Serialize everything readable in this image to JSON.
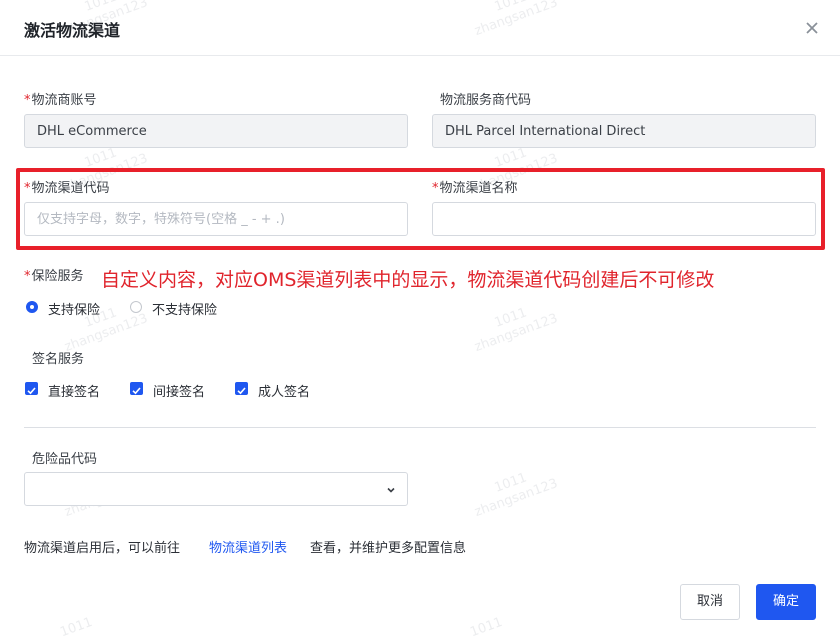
{
  "dialog": {
    "title": "激活物流渠道",
    "close_icon": "close-icon"
  },
  "fields": {
    "carrier_account": {
      "label": "物流商账号",
      "required": "*",
      "value": "DHL eCommerce"
    },
    "carrier_service_code": {
      "label": "物流服务商代码",
      "value": "DHL Parcel International Direct"
    },
    "channel_code": {
      "label": "物流渠道代码",
      "required": "*",
      "placeholder": "仅支持字母，数字，特殊符号(空格 _ - + .)"
    },
    "channel_name": {
      "label": "物流渠道名称",
      "required": "*",
      "value": ""
    }
  },
  "annotation": "自定义内容，对应OMS渠道列表中的显示，物流渠道代码创建后不可修改",
  "insurance": {
    "label": "保险服务",
    "required": "*",
    "options": [
      {
        "label": "支持保险",
        "checked": true
      },
      {
        "label": "不支持保险",
        "checked": false
      }
    ]
  },
  "signature": {
    "label": "签名服务",
    "options": [
      {
        "label": "直接签名",
        "checked": true
      },
      {
        "label": "间接签名",
        "checked": true
      },
      {
        "label": "成人签名",
        "checked": true
      }
    ]
  },
  "dangerous_goods": {
    "label": "危险品代码",
    "value": ""
  },
  "footer": {
    "text_before": "物流渠道启用后，可以前往",
    "link": "物流渠道列表",
    "text_after": "查看，并维护更多配置信息"
  },
  "buttons": {
    "cancel": "取消",
    "confirm": "确定"
  },
  "watermark": {
    "line1": "1011",
    "line2": "zhangsan123"
  },
  "colors": {
    "primary": "#1f57f0",
    "required": "#e0242c",
    "highlight": "#e8202a"
  }
}
